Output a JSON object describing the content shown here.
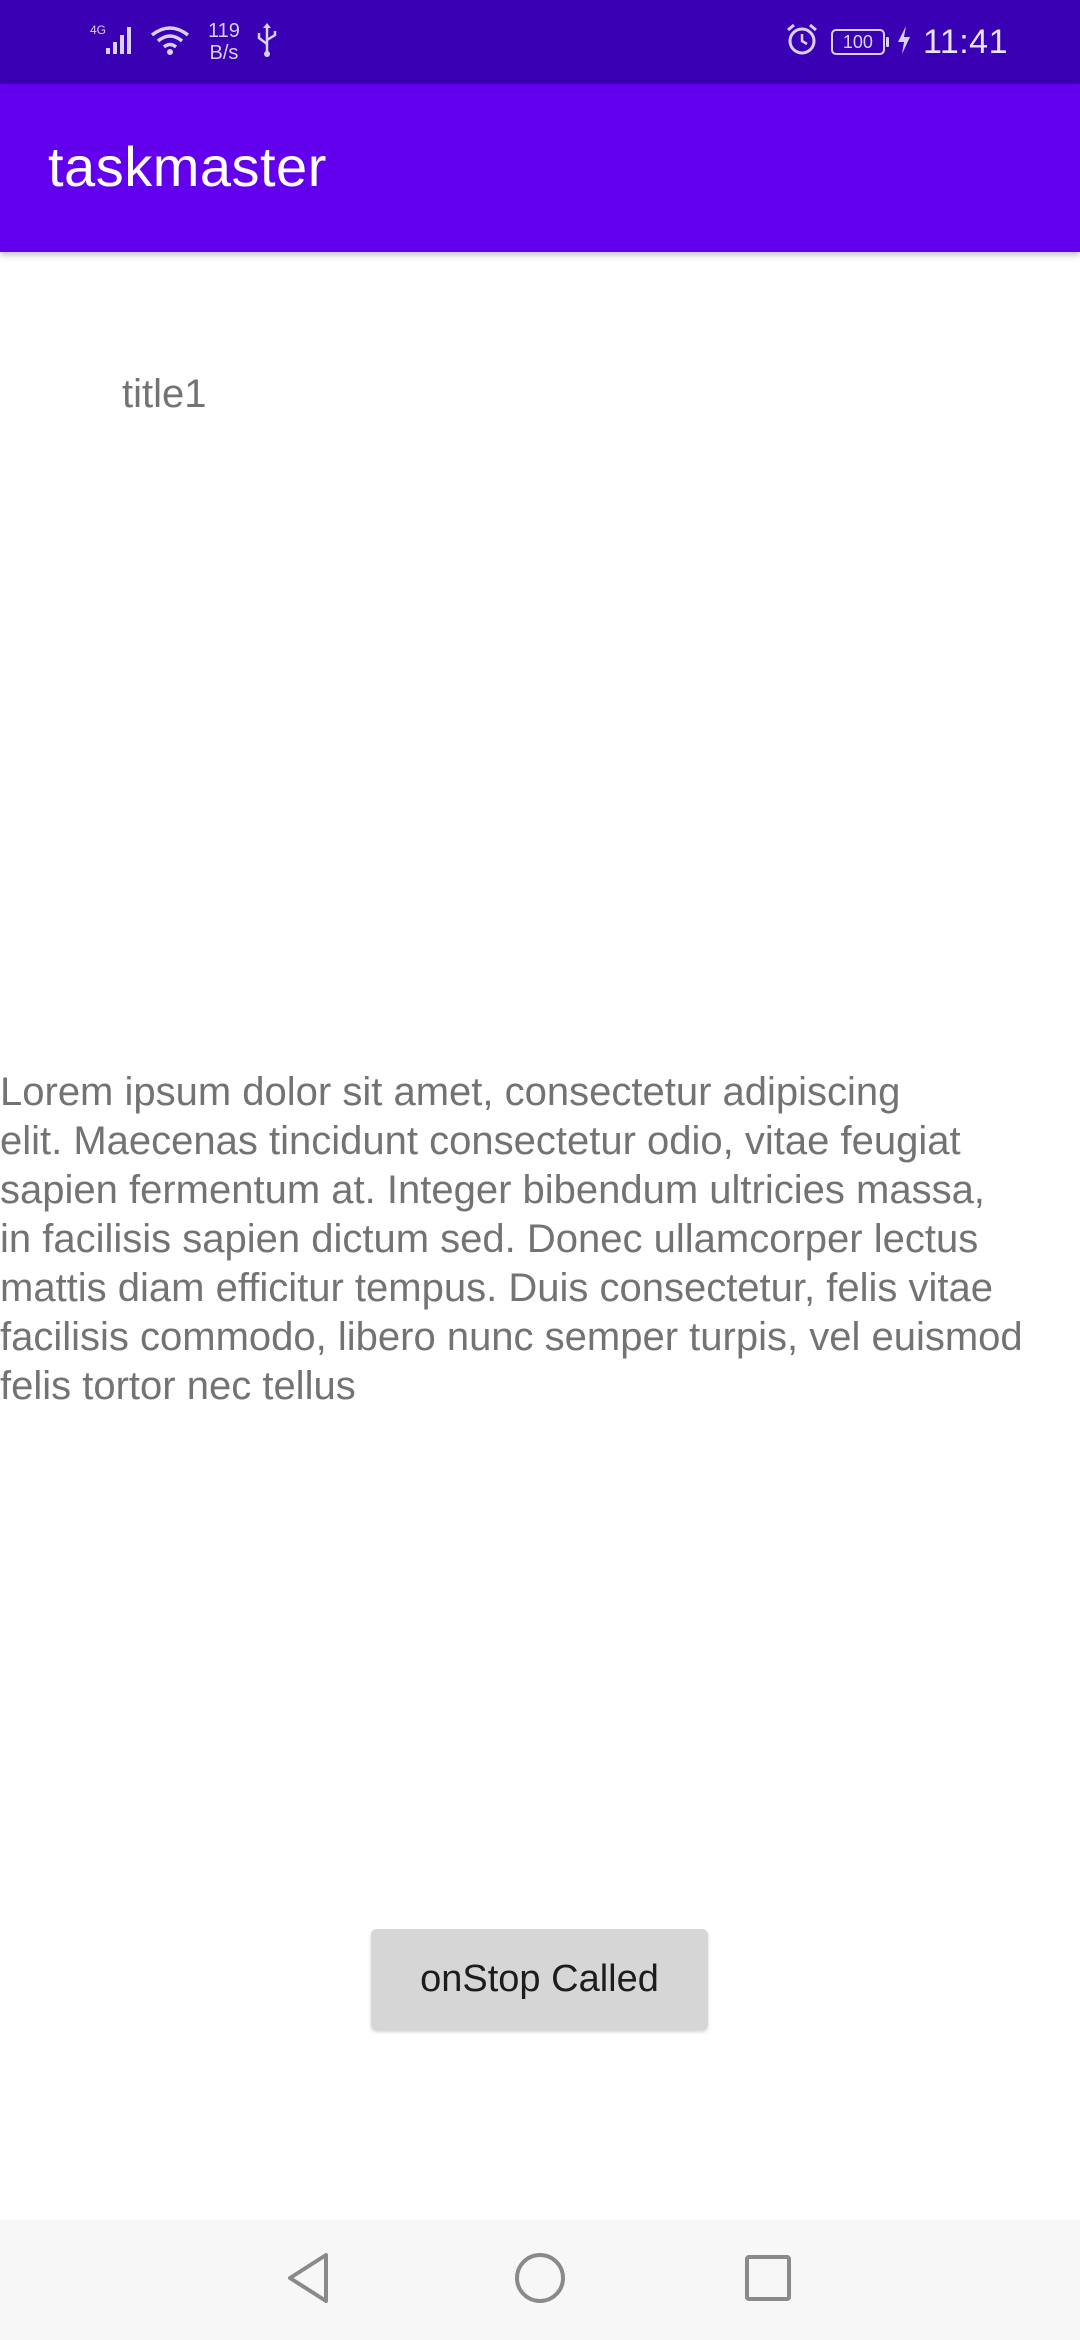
{
  "status_bar": {
    "network_type": "4G",
    "net_speed_value": "119",
    "net_speed_unit": "B/s",
    "battery_level": "100",
    "time": "11:41",
    "icons": [
      "signal-icon",
      "wifi-icon",
      "usb-icon",
      "alarm-icon",
      "battery-icon",
      "charging-icon"
    ]
  },
  "app_bar": {
    "title": "taskmaster"
  },
  "task": {
    "title": "title1",
    "body": "Lorem ipsum dolor sit amet, consectetur adipiscing\nelit. Maecenas tincidunt consectetur odio, vitae feugiat\nsapien fermentum at. Integer bibendum ultricies massa,\nin facilisis sapien dictum sed. Donec ullamcorper lectus\nmattis diam efficitur tempus. Duis consectetur, felis vitae\nfacilisis commodo, libero nunc semper turpis, vel euismod\nfelis tortor nec tellus"
  },
  "button": {
    "label": "onStop Called"
  },
  "nav_bar": {
    "icons": [
      "back-icon",
      "home-icon",
      "recents-icon"
    ]
  },
  "colors": {
    "status_bar": "#3a00b3",
    "app_bar": "#6200ee",
    "body_text": "#737373",
    "button_bg": "#d6d6d6"
  }
}
